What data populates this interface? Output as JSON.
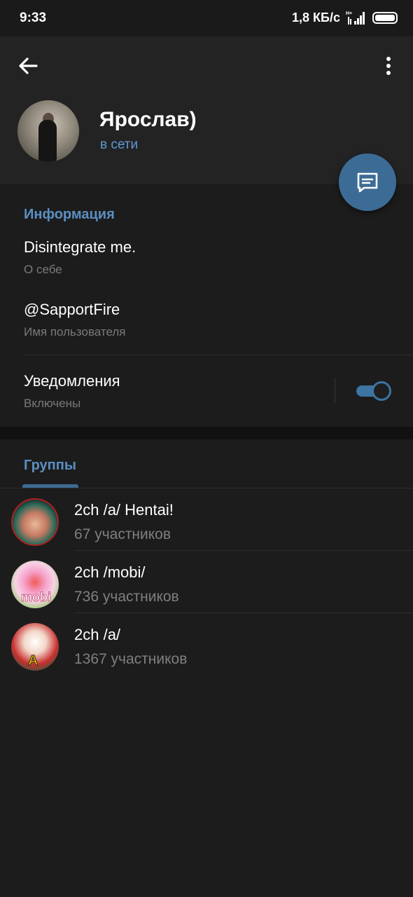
{
  "status": {
    "time": "9:33",
    "network_speed": "1,8 КБ/с"
  },
  "profile": {
    "name": "Ярослав)",
    "status": "в сети"
  },
  "info": {
    "section_title": "Информация",
    "bio": "Disintegrate me.",
    "bio_label": "О себе",
    "username": "@SapportFire",
    "username_label": "Имя пользователя",
    "notifications": "Уведомления",
    "notifications_state": "Включены",
    "notifications_enabled": true
  },
  "groups": {
    "tab_label": "Группы",
    "items": [
      {
        "name": "2ch /a/ Hentai!",
        "members": "67 участников"
      },
      {
        "name": "2ch /mobi/",
        "members": "736 участников"
      },
      {
        "name": "2ch /a/",
        "members": "1367 участников"
      }
    ]
  },
  "colors": {
    "accent": "#5b9bd5",
    "fab": "#3c6c95",
    "background": "#1c1c1c"
  }
}
